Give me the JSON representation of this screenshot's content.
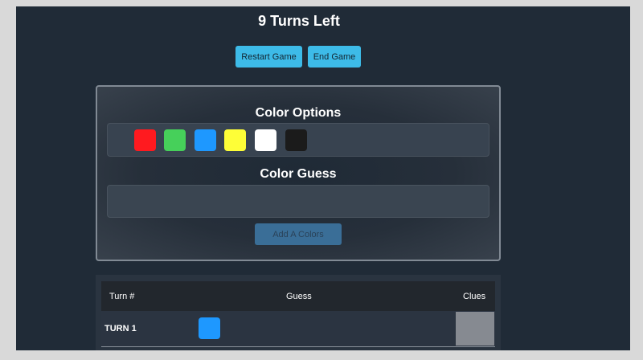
{
  "header": {
    "title": "9 Turns Left"
  },
  "controls": {
    "restart_label": "Restart Game",
    "end_label": "End Game"
  },
  "options": {
    "heading": "Color Options",
    "colors": [
      {
        "name": "red",
        "hex": "#ff1a1f"
      },
      {
        "name": "green",
        "hex": "#46d05a"
      },
      {
        "name": "blue",
        "hex": "#1e98ff"
      },
      {
        "name": "yellow",
        "hex": "#fefe37"
      },
      {
        "name": "white",
        "hex": "#ffffff"
      },
      {
        "name": "black",
        "hex": "#1b1b1b"
      }
    ]
  },
  "guess": {
    "heading": "Color Guess",
    "add_label": "Add A Colors"
  },
  "board": {
    "columns": {
      "turn": "Turn #",
      "guess": "Guess",
      "clues": "Clues"
    },
    "rows": [
      {
        "label": "TURN 1",
        "guess_colors": [
          "#1e98ff"
        ],
        "clue_color": "#868a91"
      }
    ]
  }
}
